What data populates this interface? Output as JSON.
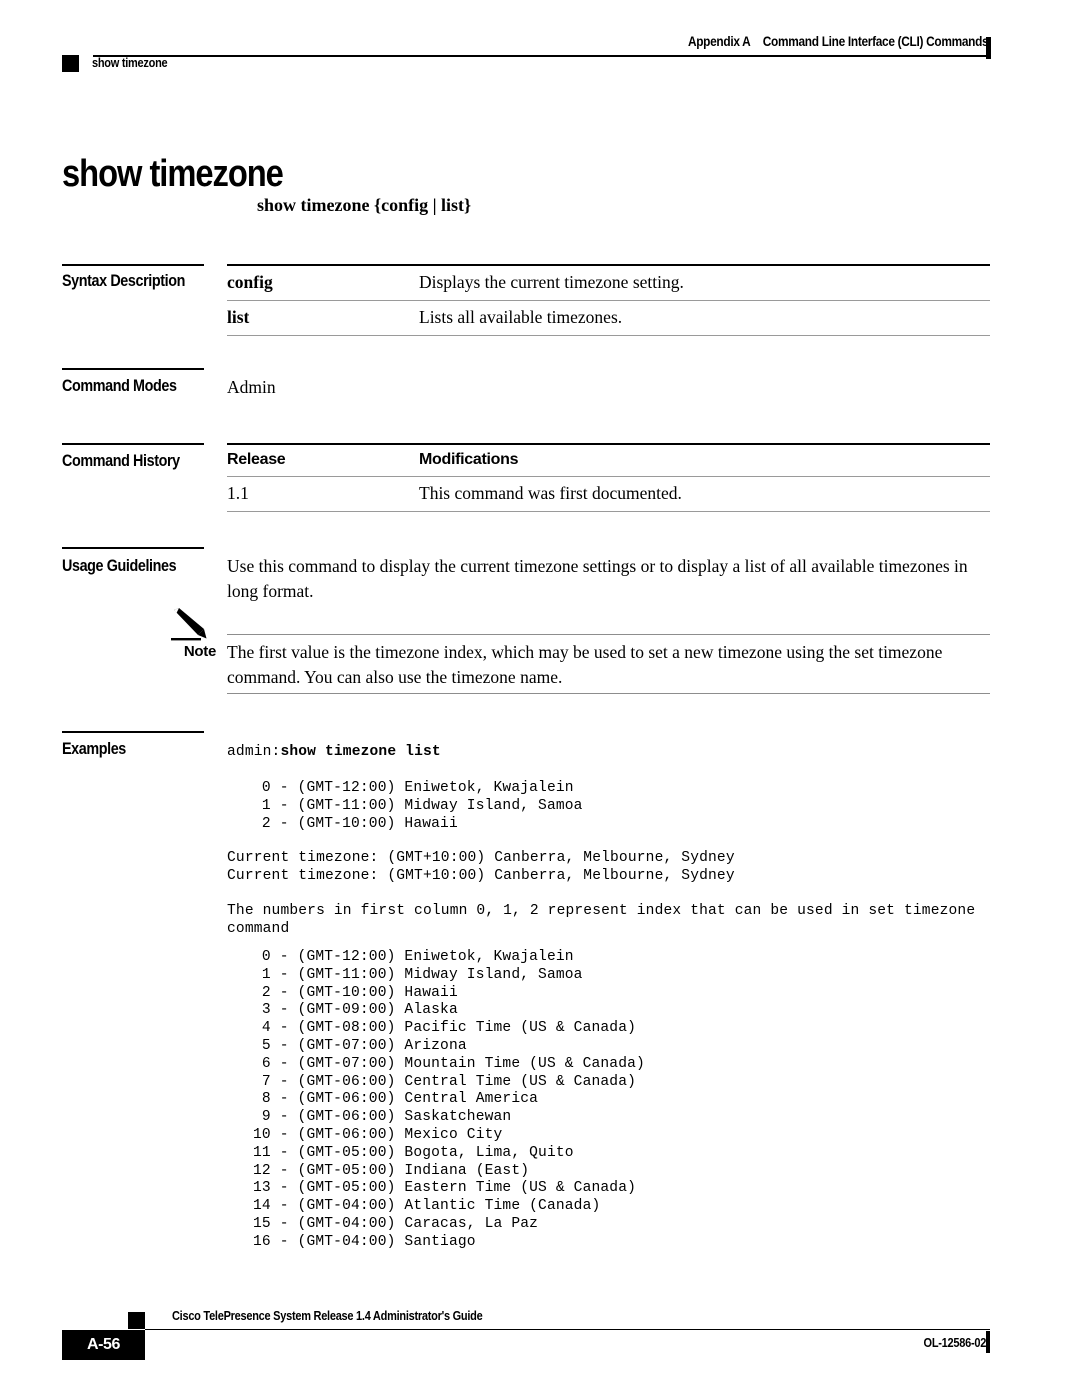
{
  "header": {
    "appendix": "Appendix A",
    "chapter": "Command Line Interface (CLI) Commands",
    "running_head": "show timezone"
  },
  "title": "show timezone",
  "syntax": "show timezone {config | list}",
  "sections": {
    "syntax_description": {
      "label": "Syntax Description",
      "rows": [
        {
          "key": "config",
          "value": "Displays the current timezone setting."
        },
        {
          "key": "list",
          "value": "Lists all available timezones."
        }
      ]
    },
    "command_modes": {
      "label": "Command Modes",
      "value": "Admin"
    },
    "command_history": {
      "label": "Command History",
      "columns": {
        "release": "Release",
        "modifications": "Modifications"
      },
      "rows": [
        {
          "release": "1.1",
          "modifications": "This command was first documented."
        }
      ]
    },
    "usage_guidelines": {
      "label": "Usage Guidelines",
      "text": "Use this command to display the current timezone settings or to display a list of all available timezones in long format."
    },
    "note": {
      "label": "Note",
      "icon": "pencil-icon",
      "text": "The first value is the timezone index, which may be used to set a new timezone using the set timezone command. You can also use the timezone name."
    },
    "examples": {
      "label": "Examples",
      "prompt": "admin:",
      "command": "show timezone list",
      "short_list": [
        " 0 - (GMT-12:00) Eniwetok, Kwajalein",
        " 1 - (GMT-11:00) Midway Island, Samoa",
        " 2 - (GMT-10:00) Hawaii"
      ],
      "current_timezone_lines": [
        "Current timezone: (GMT+10:00) Canberra, Melbourne, Sydney",
        "Current timezone: (GMT+10:00) Canberra, Melbourne, Sydney"
      ],
      "note_lines": [
        "The numbers in first column 0, 1, 2 represent index that can be used in set timezone",
        "command"
      ],
      "full_list": [
        " 0 - (GMT-12:00) Eniwetok, Kwajalein",
        " 1 - (GMT-11:00) Midway Island, Samoa",
        " 2 - (GMT-10:00) Hawaii",
        " 3 - (GMT-09:00) Alaska",
        " 4 - (GMT-08:00) Pacific Time (US & Canada)",
        " 5 - (GMT-07:00) Arizona",
        " 6 - (GMT-07:00) Mountain Time (US & Canada)",
        " 7 - (GMT-06:00) Central Time (US & Canada)",
        " 8 - (GMT-06:00) Central America",
        " 9 - (GMT-06:00) Saskatchewan",
        "10 - (GMT-06:00) Mexico City",
        "11 - (GMT-05:00) Bogota, Lima, Quito",
        "12 - (GMT-05:00) Indiana (East)",
        "13 - (GMT-05:00) Eastern Time (US & Canada)",
        "14 - (GMT-04:00) Atlantic Time (Canada)",
        "15 - (GMT-04:00) Caracas, La Paz",
        "16 - (GMT-04:00) Santiago"
      ]
    }
  },
  "footer": {
    "guide_title": "Cisco TelePresence System Release 1.4 Administrator's Guide",
    "page_number": "A-56",
    "doc_id": "OL-12586-02"
  }
}
